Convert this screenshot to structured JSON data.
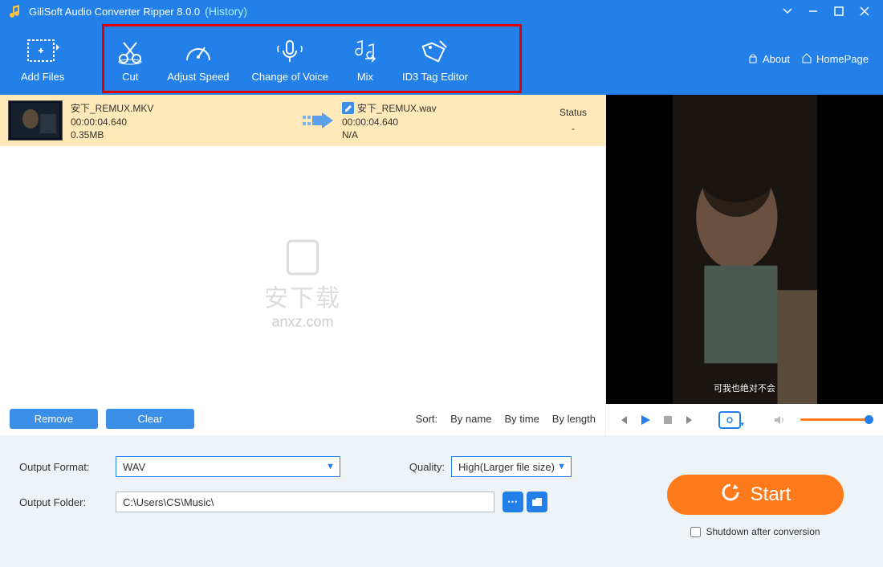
{
  "titlebar": {
    "title": "GiliSoft Audio Converter Ripper 8.0.0",
    "history": "(History)"
  },
  "toolbar": {
    "add_files": "Add Files",
    "cut": "Cut",
    "adjust_speed": "Adjust Speed",
    "change_voice": "Change of Voice",
    "mix": "Mix",
    "id3": "ID3 Tag Editor",
    "about": "About",
    "homepage": "HomePage"
  },
  "filelist": {
    "status_header": "Status",
    "status_value": "-",
    "src": {
      "name": "安下_REMUX.MKV",
      "duration": "00:00:04.640",
      "size": "0.35MB"
    },
    "dst": {
      "name": "安下_REMUX.wav",
      "duration": "00:00:04.640",
      "size": "N/A"
    }
  },
  "watermark": {
    "big": "安下载",
    "small": "anxz.com"
  },
  "listbottom": {
    "remove": "Remove",
    "clear": "Clear",
    "sort_label": "Sort:",
    "by_name": "By name",
    "by_time": "By time",
    "by_length": "By length"
  },
  "preview": {
    "subtitle": "可我也绝对不会"
  },
  "bottom": {
    "output_format_label": "Output Format:",
    "output_format_value": "WAV",
    "quality_label": "Quality:",
    "quality_value": "High(Larger file size)",
    "output_folder_label": "Output Folder:",
    "output_folder_value": "C:\\Users\\CS\\Music\\",
    "start": "Start",
    "shutdown": "Shutdown after conversion"
  }
}
